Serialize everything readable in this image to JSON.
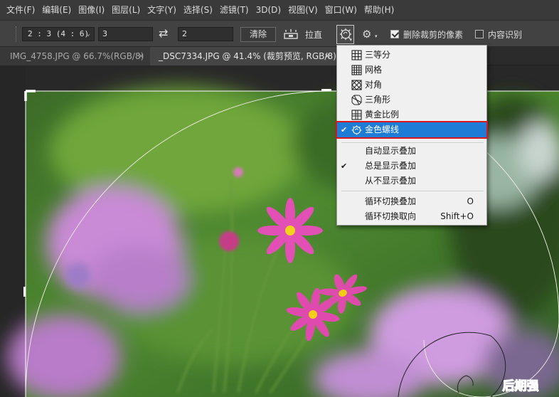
{
  "menu": [
    "文件(F)",
    "编辑(E)",
    "图像(I)",
    "图层(L)",
    "文字(Y)",
    "选择(S)",
    "滤镜(T)",
    "3D(D)",
    "视图(V)",
    "窗口(W)",
    "帮助(H)"
  ],
  "options": {
    "ratio_preset": "2 : 3 (4 : 6)",
    "width_value": "3",
    "height_value": "2",
    "clear_label": "清除",
    "straighten_label": "拉直",
    "delete_cropped_label": "删除裁剪的像素",
    "delete_cropped_checked": true,
    "content_aware_label": "内容识别",
    "content_aware_checked": false
  },
  "tabs": [
    {
      "label": "IMG_4758.JPG @ 66.7%(RGB/8)",
      "close": "×",
      "active": false
    },
    {
      "label": "_DSC7334.JPG @ 41.4% (裁剪预览, RGB/8)",
      "close": "×",
      "active": true
    }
  ],
  "overlay_menu": {
    "overlays": [
      {
        "label": "三等分",
        "icon": "rule-of-thirds-icon",
        "checked": false
      },
      {
        "label": "网格",
        "icon": "grid-icon",
        "checked": false
      },
      {
        "label": "对角",
        "icon": "diagonal-icon",
        "checked": false
      },
      {
        "label": "三角形",
        "icon": "triangle-icon",
        "checked": false
      },
      {
        "label": "黄金比例",
        "icon": "golden-ratio-icon",
        "checked": false
      },
      {
        "label": "金色螺线",
        "icon": "golden-spiral-icon",
        "checked": true
      }
    ],
    "display_modes": [
      {
        "label": "自动显示叠加",
        "checked": false
      },
      {
        "label": "总是显示叠加",
        "checked": true
      },
      {
        "label": "从不显示叠加",
        "checked": false
      }
    ],
    "cycle": [
      {
        "label": "循环切换叠加",
        "shortcut": "O"
      },
      {
        "label": "循环切换取向",
        "shortcut": "Shift+O"
      }
    ],
    "check_mark": "✔"
  },
  "watermark": "后期强",
  "colors": {
    "selected_item_bg": "#1e7bd6",
    "highlight_outline": "#d8181c",
    "menubar_bg": "#3a3a3a",
    "optionsbar_bg": "#424242"
  }
}
